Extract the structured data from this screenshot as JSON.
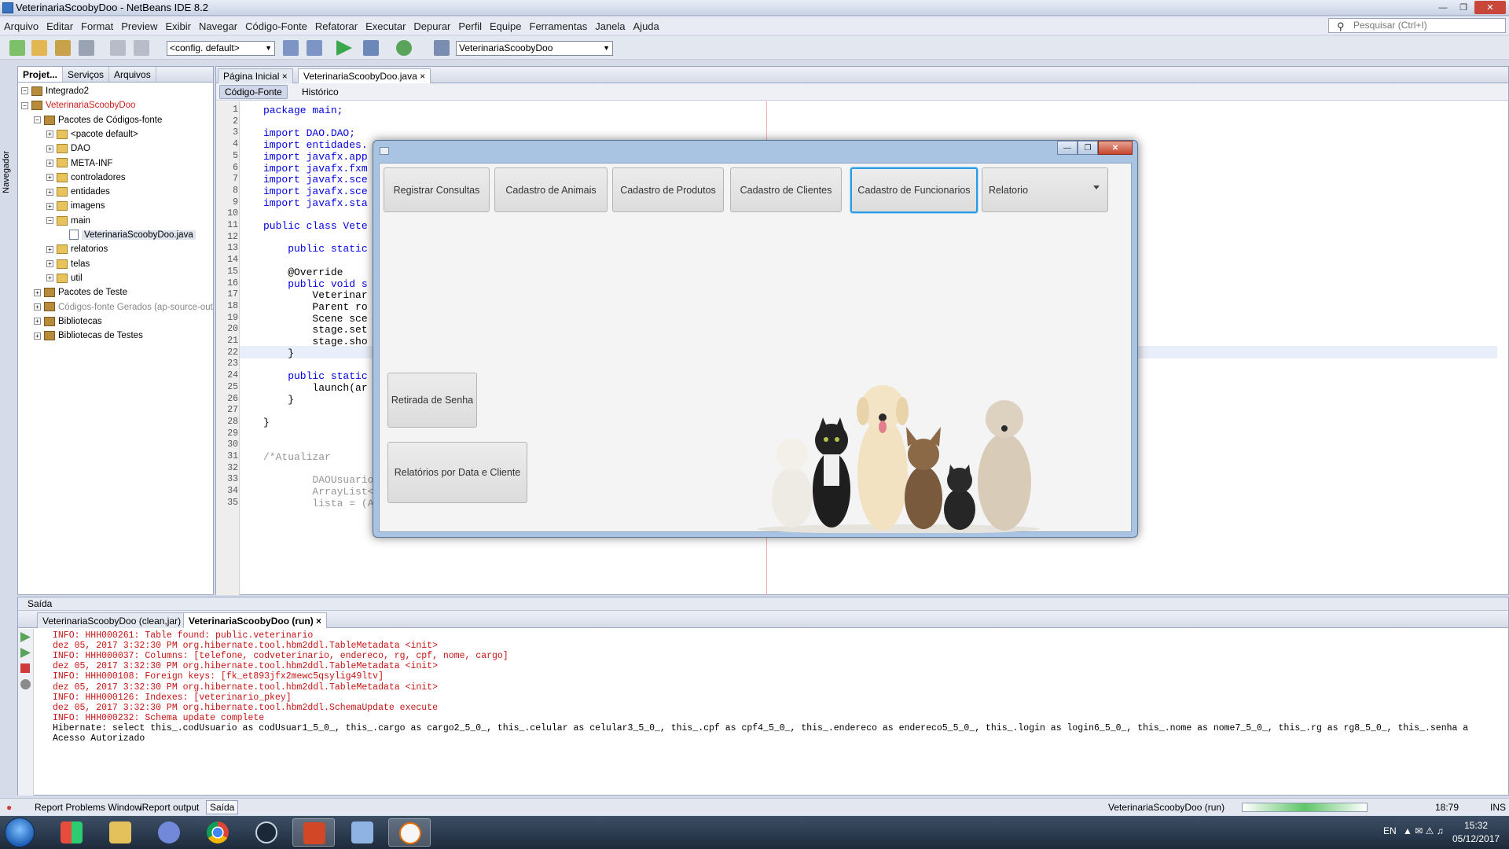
{
  "window": {
    "title": "VeterinariaScoobyDoo - NetBeans IDE 8.2"
  },
  "menu": [
    "Arquivo",
    "Editar",
    "Format",
    "Preview",
    "Exibir",
    "Navegar",
    "Código-Fonte",
    "Refatorar",
    "Executar",
    "Depurar",
    "Perfil",
    "Equipe",
    "Ferramentas",
    "Janela",
    "Ajuda"
  ],
  "search": {
    "placeholder": "Pesquisar (Ctrl+I)"
  },
  "toolbar": {
    "config": "<config. default>",
    "project_combo": "VeterinariaScoobyDoo"
  },
  "sidebar": {
    "navigator_label": "Navegador"
  },
  "project_panel": {
    "tabs": [
      "Projet...",
      "Serviços",
      "Arquivos"
    ],
    "tree": [
      {
        "label": "Integrado2",
        "level": 0,
        "icon": "project-icon"
      },
      {
        "label": "VeterinariaScoobyDoo",
        "level": 0,
        "icon": "project-icon",
        "color": "#d02020"
      },
      {
        "label": "Pacotes de Códigos-fonte",
        "level": 1,
        "icon": "package-folder-icon"
      },
      {
        "label": "<pacote default>",
        "level": 2,
        "icon": "package-icon"
      },
      {
        "label": "DAO",
        "level": 2,
        "icon": "package-icon"
      },
      {
        "label": "META-INF",
        "level": 2,
        "icon": "package-icon"
      },
      {
        "label": "controladores",
        "level": 2,
        "icon": "package-icon"
      },
      {
        "label": "entidades",
        "level": 2,
        "icon": "package-icon"
      },
      {
        "label": "imagens",
        "level": 2,
        "icon": "package-icon"
      },
      {
        "label": "main",
        "level": 2,
        "icon": "package-icon"
      },
      {
        "label": "VeterinariaScoobyDoo.java",
        "level": 3,
        "icon": "java-file-icon",
        "selected": true
      },
      {
        "label": "relatorios",
        "level": 2,
        "icon": "package-icon"
      },
      {
        "label": "telas",
        "level": 2,
        "icon": "package-icon"
      },
      {
        "label": "util",
        "level": 2,
        "icon": "package-icon"
      },
      {
        "label": "Pacotes de Teste",
        "level": 1,
        "icon": "package-folder-icon"
      },
      {
        "label": "Códigos-fonte Gerados (ap-source-out",
        "level": 1,
        "icon": "package-folder-icon",
        "color": "#888888"
      },
      {
        "label": "Bibliotecas",
        "level": 1,
        "icon": "library-icon"
      },
      {
        "label": "Bibliotecas de Testes",
        "level": 1,
        "icon": "library-icon"
      }
    ]
  },
  "editor": {
    "tabs": [
      "Página Inicial",
      "VeterinariaScoobyDoo.java"
    ],
    "source_btn": "Código-Fonte",
    "history_btn": "Histórico",
    "lines": [
      {
        "n": "1",
        "t": "package main;"
      },
      {
        "n": "2",
        "t": ""
      },
      {
        "n": "3",
        "t": "import DAO.DAO;"
      },
      {
        "n": "4",
        "t": "import entidades."
      },
      {
        "n": "5",
        "t": "import javafx.app"
      },
      {
        "n": "6",
        "t": "import javafx.fxm"
      },
      {
        "n": "7",
        "t": "import javafx.sce"
      },
      {
        "n": "8",
        "t": "import javafx.sce"
      },
      {
        "n": "9",
        "t": "import javafx.sta"
      },
      {
        "n": "10",
        "t": ""
      },
      {
        "n": "11",
        "t": "public class Vete"
      },
      {
        "n": "12",
        "t": ""
      },
      {
        "n": "13",
        "t": "    public static"
      },
      {
        "n": "14",
        "t": ""
      },
      {
        "n": "15",
        "t": "    @Override"
      },
      {
        "n": "16",
        "t": "    public void s"
      },
      {
        "n": "17",
        "t": "        Veterinar"
      },
      {
        "n": "18",
        "t": "        Parent ro"
      },
      {
        "n": "19",
        "t": "        Scene sce"
      },
      {
        "n": "20",
        "t": "        stage.set"
      },
      {
        "n": "21",
        "t": "        stage.sho"
      },
      {
        "n": "22",
        "t": "    }"
      },
      {
        "n": "23",
        "t": ""
      },
      {
        "n": "24",
        "t": "    public static"
      },
      {
        "n": "25",
        "t": "        launch(ar"
      },
      {
        "n": "26",
        "t": "    }"
      },
      {
        "n": "27",
        "t": ""
      },
      {
        "n": "28",
        "t": "}"
      },
      {
        "n": "29",
        "t": ""
      },
      {
        "n": "30",
        "t": ""
      },
      {
        "n": "31",
        "t": "/*Atualizar"
      },
      {
        "n": "32",
        "t": ""
      },
      {
        "n": "33",
        "t": "        DAOUsuario dao = new DAOUsuario();"
      },
      {
        "n": "34",
        "t": "        ArrayList<Usuario> lista;"
      },
      {
        "n": "35",
        "t": "        lista = (ArrayList<Usuario>) dao.validaLogin(\"allanfraga\", \"1234\");"
      }
    ]
  },
  "dialog": {
    "buttons": [
      "Registrar Consultas",
      "Cadastro de Animais",
      "Cadastro de Produtos",
      "Cadastro de Clientes",
      "Cadastro de Funcionarios"
    ],
    "report_combo": "Relatorio",
    "ticket_btn": "Retirada de Senha",
    "report_btn": "Relatórios por Data e Cliente"
  },
  "output": {
    "header": "Saída",
    "tabs": [
      "VeterinariaScoobyDoo (clean,jar)",
      "VeterinariaScoobyDoo (run)"
    ],
    "lines": [
      {
        "t": "INFO: HHH000261: Table found: public.veterinario",
        "c": "red"
      },
      {
        "t": "dez 05, 2017 3:32:30 PM org.hibernate.tool.hbm2ddl.TableMetadata <init>",
        "c": "red"
      },
      {
        "t": "INFO: HHH000037: Columns: [telefone, codveterinario, endereco, rg, cpf, nome, cargo]",
        "c": "red"
      },
      {
        "t": "dez 05, 2017 3:32:30 PM org.hibernate.tool.hbm2ddl.TableMetadata <init>",
        "c": "red"
      },
      {
        "t": "INFO: HHH000108: Foreign keys: [fk_et893jfx2mewc5qsylig49ltv]",
        "c": "red"
      },
      {
        "t": "dez 05, 2017 3:32:30 PM org.hibernate.tool.hbm2ddl.TableMetadata <init>",
        "c": "red"
      },
      {
        "t": "INFO: HHH000126: Indexes: [veterinario_pkey]",
        "c": "red"
      },
      {
        "t": "dez 05, 2017 3:32:30 PM org.hibernate.tool.hbm2ddl.SchemaUpdate execute",
        "c": "red"
      },
      {
        "t": "INFO: HHH000232: Schema update complete",
        "c": "red"
      },
      {
        "t": "Hibernate: select this_.codUsuario as codUsuar1_5_0_, this_.cargo as cargo2_5_0_, this_.celular as celular3_5_0_, this_.cpf as cpf4_5_0_, this_.endereco as endereco5_5_0_, this_.login as login6_5_0_, this_.nome as nome7_5_0_, this_.rg as rg8_5_0_, this_.senha a",
        "c": "black"
      },
      {
        "t": "Acesso Autorizado",
        "c": "black"
      }
    ]
  },
  "statusbar": {
    "report_problems": "Report Problems Window",
    "ireport": "iReport output",
    "saida": "Saída",
    "project": "VeterinariaScoobyDoo (run)",
    "position": "18:79",
    "mode": "INS"
  },
  "taskbar": {
    "lang": "EN",
    "time": "15:32",
    "date": "05/12/2017",
    "apps": [
      "windows-start-icon",
      "office-icon",
      "explorer-icon",
      "discord-icon",
      "chrome-icon",
      "steam-icon",
      "presentation-app-icon",
      "virtualbox-icon",
      "java-icon"
    ]
  }
}
